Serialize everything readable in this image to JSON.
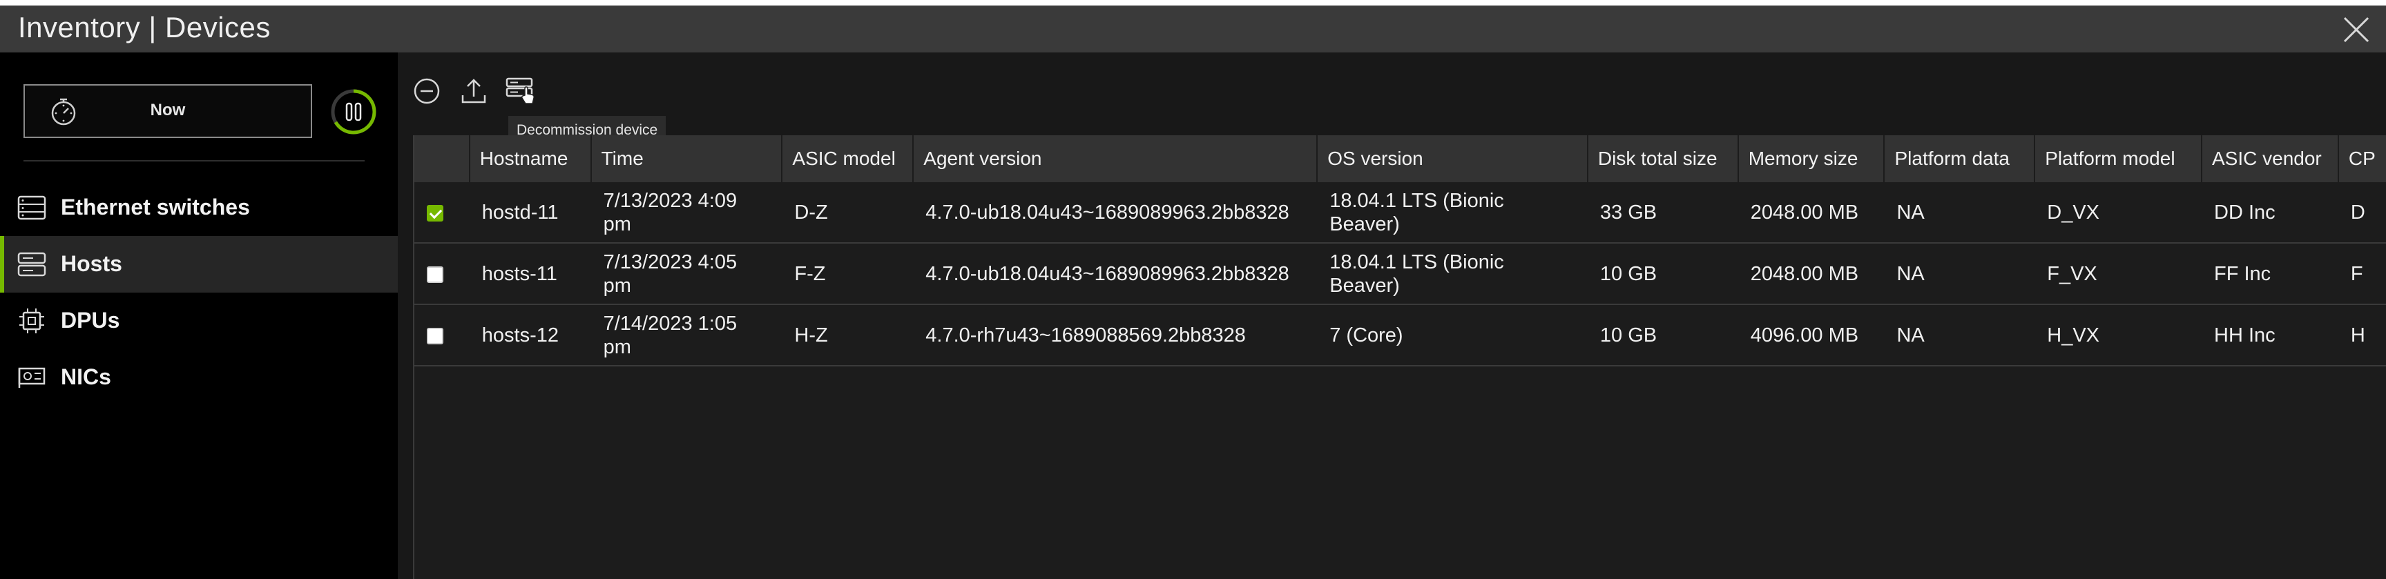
{
  "window": {
    "title": "Inventory | Devices"
  },
  "time_control": {
    "label": "Now"
  },
  "sidebar": {
    "items": [
      {
        "label": "Ethernet switches",
        "icon": "switch-icon",
        "active": false
      },
      {
        "label": "Hosts",
        "icon": "server-icon",
        "active": true
      },
      {
        "label": "DPUs",
        "icon": "chip-icon",
        "active": false
      },
      {
        "label": "NICs",
        "icon": "nic-icon",
        "active": false
      }
    ]
  },
  "toolbar": {
    "tools": [
      "remove-icon",
      "export-icon",
      "decommission-icon"
    ],
    "tooltip": "Decommission device"
  },
  "table": {
    "columns": [
      "Hostname",
      "Time",
      "ASIC model",
      "Agent version",
      "OS version",
      "Disk total size",
      "Memory size",
      "Platform data",
      "Platform model",
      "ASIC vendor",
      "CP"
    ],
    "rows": [
      {
        "checked": true,
        "cells": [
          "hostd-11",
          "7/13/2023 4:09 pm",
          "D-Z",
          "4.7.0-ub18.04u43~1689089963.2bb8328",
          "18.04.1 LTS (Bionic Beaver)",
          "33 GB",
          "2048.00 MB",
          "NA",
          "D_VX",
          "DD Inc",
          "D"
        ]
      },
      {
        "checked": false,
        "cells": [
          "hosts-11",
          "7/13/2023 4:05 pm",
          "F-Z",
          "4.7.0-ub18.04u43~1689089963.2bb8328",
          "18.04.1 LTS (Bionic Beaver)",
          "10 GB",
          "2048.00 MB",
          "NA",
          "F_VX",
          "FF Inc",
          "F"
        ]
      },
      {
        "checked": false,
        "cells": [
          "hosts-12",
          "7/14/2023 1:05 pm",
          "H-Z",
          "4.7.0-rh7u43~1689088569.2bb8328",
          "7 (Core)",
          "10 GB",
          "4096.00 MB",
          "NA",
          "H_VX",
          "HH Inc",
          "H"
        ]
      }
    ]
  },
  "colors": {
    "accent": "#76b900",
    "background": "#181818",
    "header": "#333333",
    "titlebar": "#3a3a3a"
  }
}
